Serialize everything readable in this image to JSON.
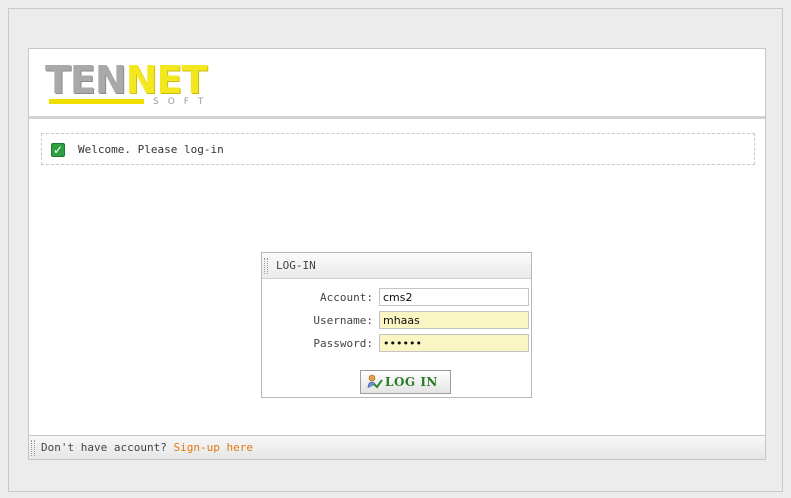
{
  "logo": {
    "part1": "TEN",
    "part2": "NET",
    "sub": "SOFT"
  },
  "welcome": {
    "message": "Welcome. Please log-in",
    "icon": "check-icon"
  },
  "login": {
    "title": "LOG-IN",
    "fields": [
      {
        "label": "Account:",
        "value": "cms2"
      },
      {
        "label": "Username:",
        "value": "mhaas"
      },
      {
        "label": "Password:",
        "value": "••••••"
      }
    ],
    "button_label": "LOG IN"
  },
  "footer": {
    "prompt": "Don't have account?",
    "link": "Sign-up here"
  },
  "colors": {
    "accent_link": "#e07a12",
    "button_text": "#2a7a2a",
    "field_highlight": "#faf6c4",
    "logo_yellow": "#f3e71d"
  }
}
